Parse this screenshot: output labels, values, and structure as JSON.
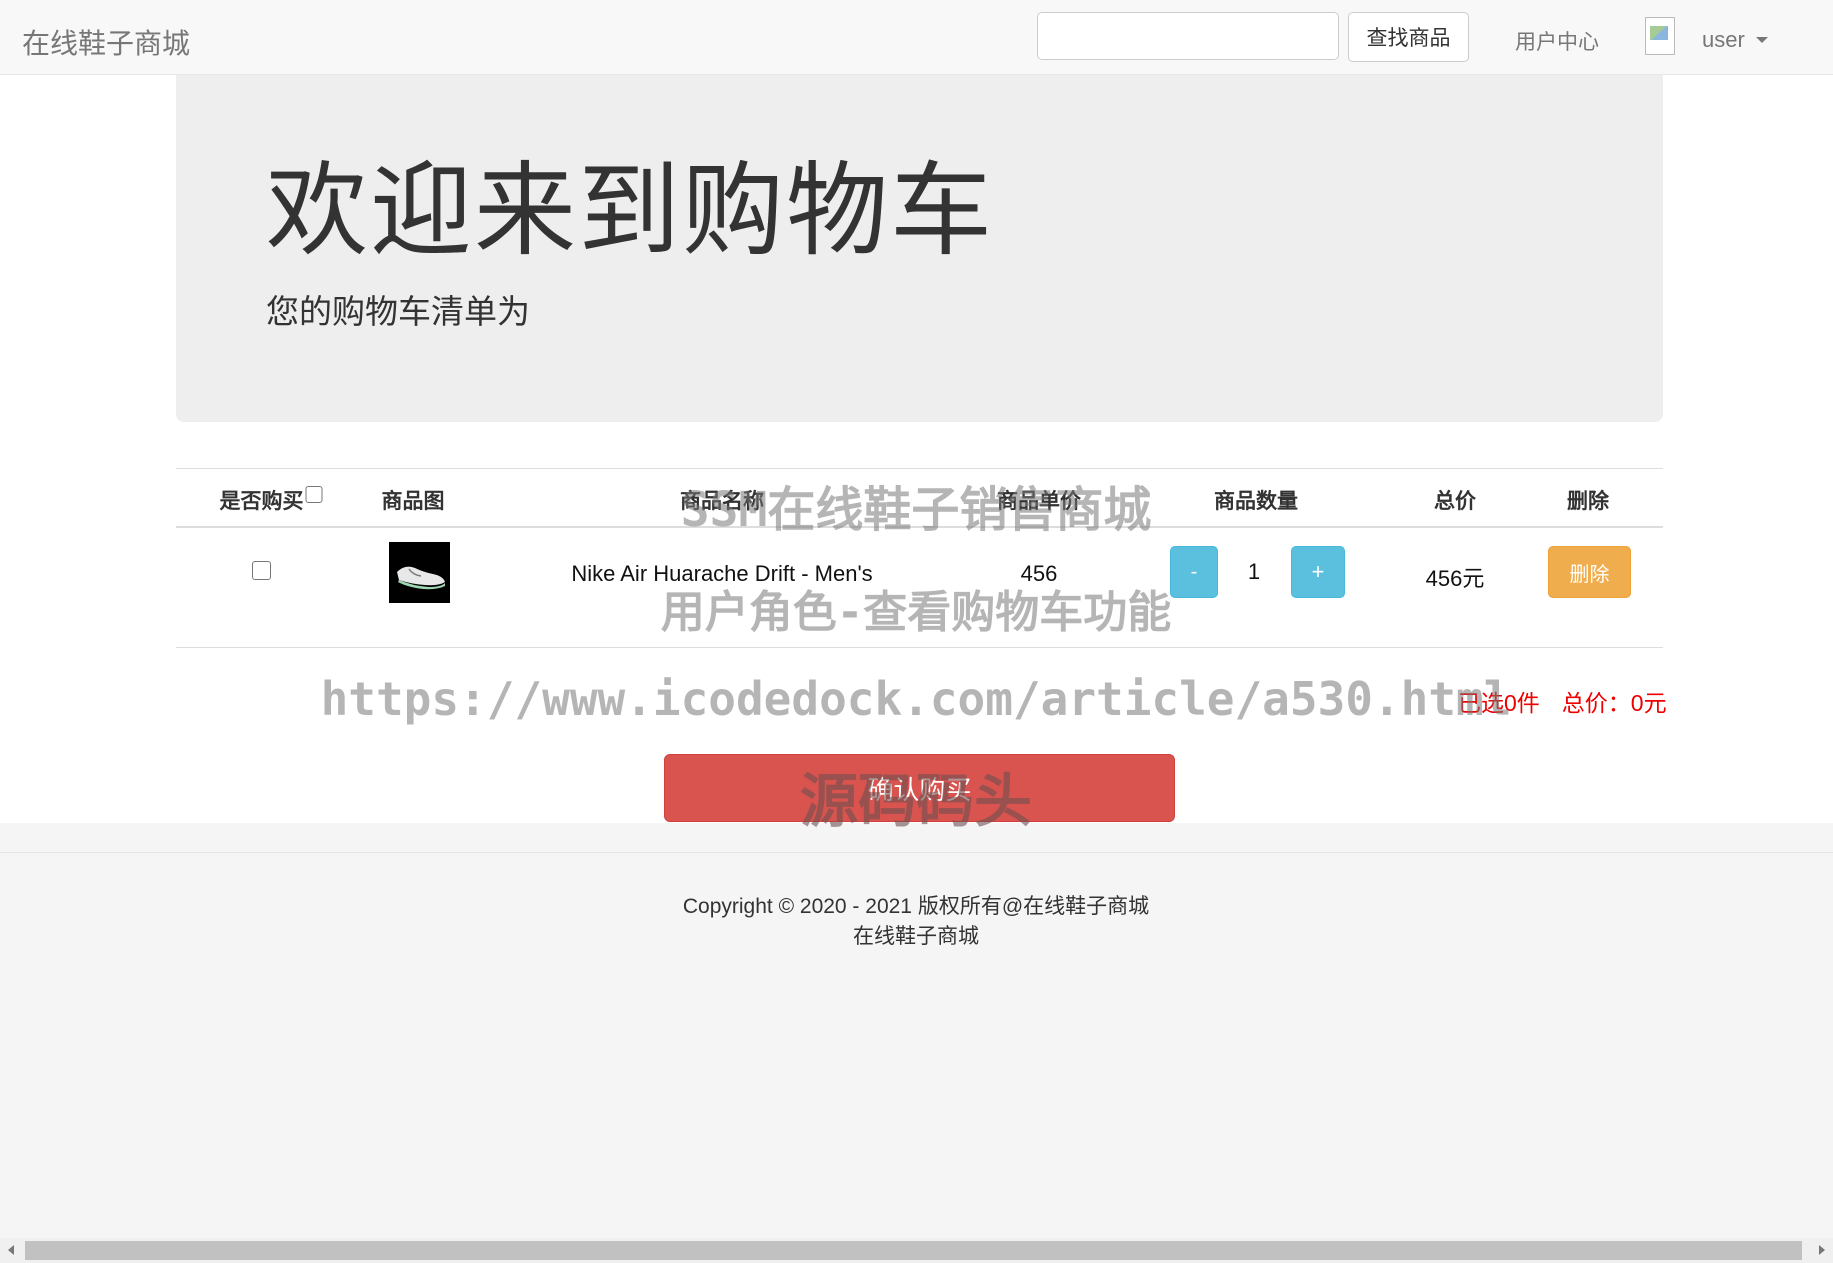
{
  "navbar": {
    "brand": "在线鞋子商城",
    "search_placeholder": "",
    "search_button": "查找商品",
    "user_center": "用户中心",
    "user_name": "user"
  },
  "jumbotron": {
    "title": "欢迎来到购物车",
    "subtitle": "您的购物车清单为"
  },
  "cart": {
    "headers": [
      "是否购买",
      "商品图",
      "商品名称",
      "商品单价",
      "商品数量",
      "总价",
      "删除"
    ],
    "rows": [
      {
        "checked": false,
        "name": "Nike Air Huarache Drift - Men's",
        "unit_price": "456",
        "minus": "-",
        "quantity": "1",
        "plus": "+",
        "total": "456元",
        "delete": "删除"
      }
    ]
  },
  "summary": {
    "selected": "已选0件",
    "total": "总价：0元"
  },
  "confirm_button": "确认购买",
  "footer": {
    "copyright": "Copyright © 2020 - 2021 版权所有@在线鞋子商城",
    "name": "在线鞋子商城"
  },
  "watermark": {
    "line1": "SSM在线鞋子销售商城",
    "line2": "用户角色-查看购物车功能",
    "line3": "https://www.icodedock.com/article/a530.html",
    "line4": "源码码头"
  },
  "colors": {
    "info_button": "#5bc0de",
    "warning_button": "#f0ad4e",
    "danger_button": "#d9534f",
    "summary_text": "#ee0000"
  }
}
